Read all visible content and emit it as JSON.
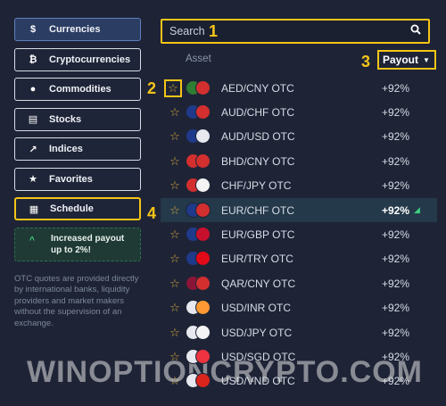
{
  "sidebar": {
    "categories": [
      {
        "label": "Currencies",
        "icon": "$",
        "active": true
      },
      {
        "label": "Cryptocurrencies",
        "icon": "₿"
      },
      {
        "label": "Commodities",
        "icon": "●"
      },
      {
        "label": "Stocks",
        "icon": "▤"
      },
      {
        "label": "Indices",
        "icon": "↗"
      },
      {
        "label": "Favorites",
        "icon": "★"
      },
      {
        "label": "Schedule",
        "icon": "▦"
      }
    ],
    "promo": "Increased payout up to 2%!",
    "note": "OTC quotes are provided directly by international banks, liquidity providers and market makers without the supervision of an exchange."
  },
  "search": {
    "placeholder": "Search"
  },
  "table": {
    "asset_header": "Asset",
    "payout_header": "Payout",
    "rows": [
      {
        "pair": "AED/CNY OTC",
        "payout": "+92%",
        "flags": [
          "#2e7d32",
          "#d32f2f"
        ]
      },
      {
        "pair": "AUD/CHF OTC",
        "payout": "+92%",
        "flags": [
          "#1f3a8a",
          "#d32f2f"
        ]
      },
      {
        "pair": "AUD/USD OTC",
        "payout": "+92%",
        "flags": [
          "#1f3a8a",
          "#e8e8f0"
        ]
      },
      {
        "pair": "BHD/CNY OTC",
        "payout": "+92%",
        "flags": [
          "#d32f2f",
          "#d32f2f"
        ]
      },
      {
        "pair": "CHF/JPY OTC",
        "payout": "+92%",
        "flags": [
          "#d32f2f",
          "#f4f4f4"
        ]
      },
      {
        "pair": "EUR/CHF OTC",
        "payout": "+92%",
        "flags": [
          "#1f3a8a",
          "#d32f2f"
        ]
      },
      {
        "pair": "EUR/GBP OTC",
        "payout": "+92%",
        "flags": [
          "#1f3a8a",
          "#c8102e"
        ]
      },
      {
        "pair": "EUR/TRY OTC",
        "payout": "+92%",
        "flags": [
          "#1f3a8a",
          "#e30a17"
        ]
      },
      {
        "pair": "QAR/CNY OTC",
        "payout": "+92%",
        "flags": [
          "#8a1538",
          "#d32f2f"
        ]
      },
      {
        "pair": "USD/INR OTC",
        "payout": "+92%",
        "flags": [
          "#e8e8f0",
          "#ff9933"
        ]
      },
      {
        "pair": "USD/JPY OTC",
        "payout": "+92%",
        "flags": [
          "#e8e8f0",
          "#f4f4f4"
        ]
      },
      {
        "pair": "USD/SGD OTC",
        "payout": "+92%",
        "flags": [
          "#e8e8f0",
          "#ef3340"
        ]
      },
      {
        "pair": "USD/VND OTC",
        "payout": "+92%",
        "flags": [
          "#e8e8f0",
          "#da251d"
        ]
      }
    ]
  },
  "annotations": [
    "1",
    "2",
    "3",
    "4"
  ],
  "watermark": "WINOPTIONCRYPTO.COM",
  "colors": {
    "background": "#1e2436",
    "highlight": "#f5c518",
    "up": "#3dcf7f",
    "star": "#d9a93a"
  }
}
